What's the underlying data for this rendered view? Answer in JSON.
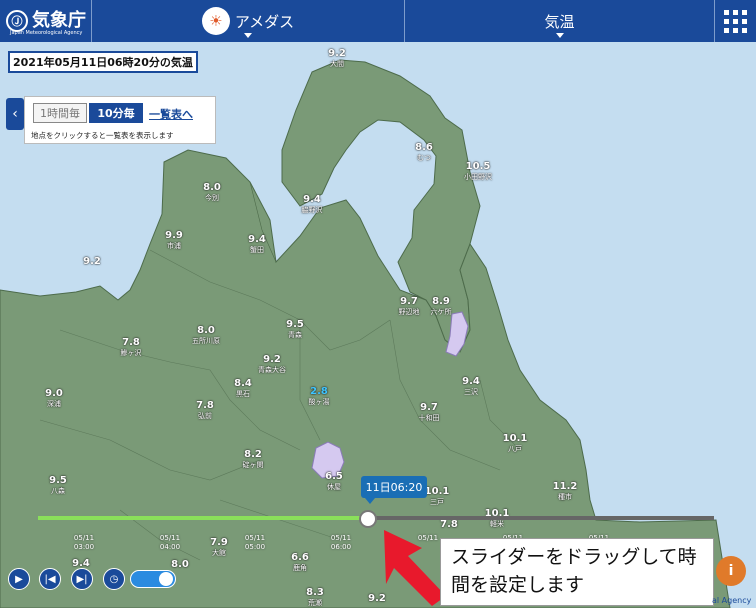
{
  "header": {
    "logo_text": "気象庁",
    "logo_sub": "Japan Meteorological Agency",
    "amedas_label": "アメダス",
    "element_label": "気温",
    "menu_icon": "grid-menu-icon"
  },
  "timestamp": "2021年05月11日06時20分の気温",
  "panel": {
    "hourly_label": "1時間毎",
    "tenmin_label": "10分毎",
    "list_link": "一覧表へ",
    "hint": "地点をクリックすると一覧表を表示します"
  },
  "stations": [
    {
      "value": "9.2",
      "name": "大間"
    },
    {
      "value": "8.6",
      "name": "むつ"
    },
    {
      "value": "10.5",
      "name": "小田野沢"
    },
    {
      "value": "8.0",
      "name": "今別"
    },
    {
      "value": "9.4",
      "name": "脇野沢"
    },
    {
      "value": "9.9",
      "name": "市浦"
    },
    {
      "value": "9.4",
      "name": "蟹田"
    },
    {
      "value": "9.7",
      "name": "野辺地"
    },
    {
      "value": "8.9",
      "name": "六ケ所"
    },
    {
      "value": "8.0",
      "name": "五所川原"
    },
    {
      "value": "9.5",
      "name": "青森"
    },
    {
      "value": "7.8",
      "name": "鰺ヶ沢"
    },
    {
      "value": "9.2",
      "name": "青森大谷"
    },
    {
      "value": "8.4",
      "name": "黒石"
    },
    {
      "value": "2.8",
      "name": "酸ヶ湯"
    },
    {
      "value": "9.4",
      "name": "三沢"
    },
    {
      "value": "9.0",
      "name": "深浦"
    },
    {
      "value": "7.8",
      "name": "弘前"
    },
    {
      "value": "9.7",
      "name": "十和田"
    },
    {
      "value": "10.1",
      "name": "八戸"
    },
    {
      "value": "8.2",
      "name": "碇ヶ関"
    },
    {
      "value": "6.5",
      "name": "休屋"
    },
    {
      "value": "9.5",
      "name": "八森"
    },
    {
      "value": "10.1",
      "name": "三戸"
    },
    {
      "value": "11.2",
      "name": "種市"
    },
    {
      "value": "7.8",
      "name": ""
    },
    {
      "value": "10.1",
      "name": "軽米"
    },
    {
      "value": "7.9",
      "name": "大館"
    },
    {
      "value": "6.6",
      "name": "鹿角"
    },
    {
      "value": "8.3",
      "name": "荒瀬"
    },
    {
      "value": "9.2",
      "name": ""
    },
    {
      "value": "9.4",
      "name": ""
    },
    {
      "value": "8.0",
      "name": ""
    },
    {
      "value": "9.2",
      "name": ""
    }
  ],
  "slider": {
    "current_label": "11日06:20",
    "progress": 0.49,
    "ticks": [
      [
        "05/11",
        "03:00"
      ],
      [
        "05/11",
        "04:00"
      ],
      [
        "05/11",
        "05:00"
      ],
      [
        "05/11",
        "06:00"
      ],
      [
        "05/11",
        ""
      ],
      [
        "05/11",
        ""
      ],
      [
        "05/11",
        ""
      ]
    ]
  },
  "controls": {
    "play_icon": "play-icon",
    "prev_icon": "step-back-icon",
    "next_icon": "step-forward-icon",
    "timer_icon": "clock-icon"
  },
  "annotation": "スライダーをドラッグして時間を設定します",
  "bottom_right_label": "al Agency",
  "colors": {
    "land": "#7a9a77",
    "sea": "#c4ddf0",
    "header": "#1a4a9a",
    "lake": "#d5c9f0",
    "fill": "#8ae05a",
    "arrow": "#e8192c"
  }
}
